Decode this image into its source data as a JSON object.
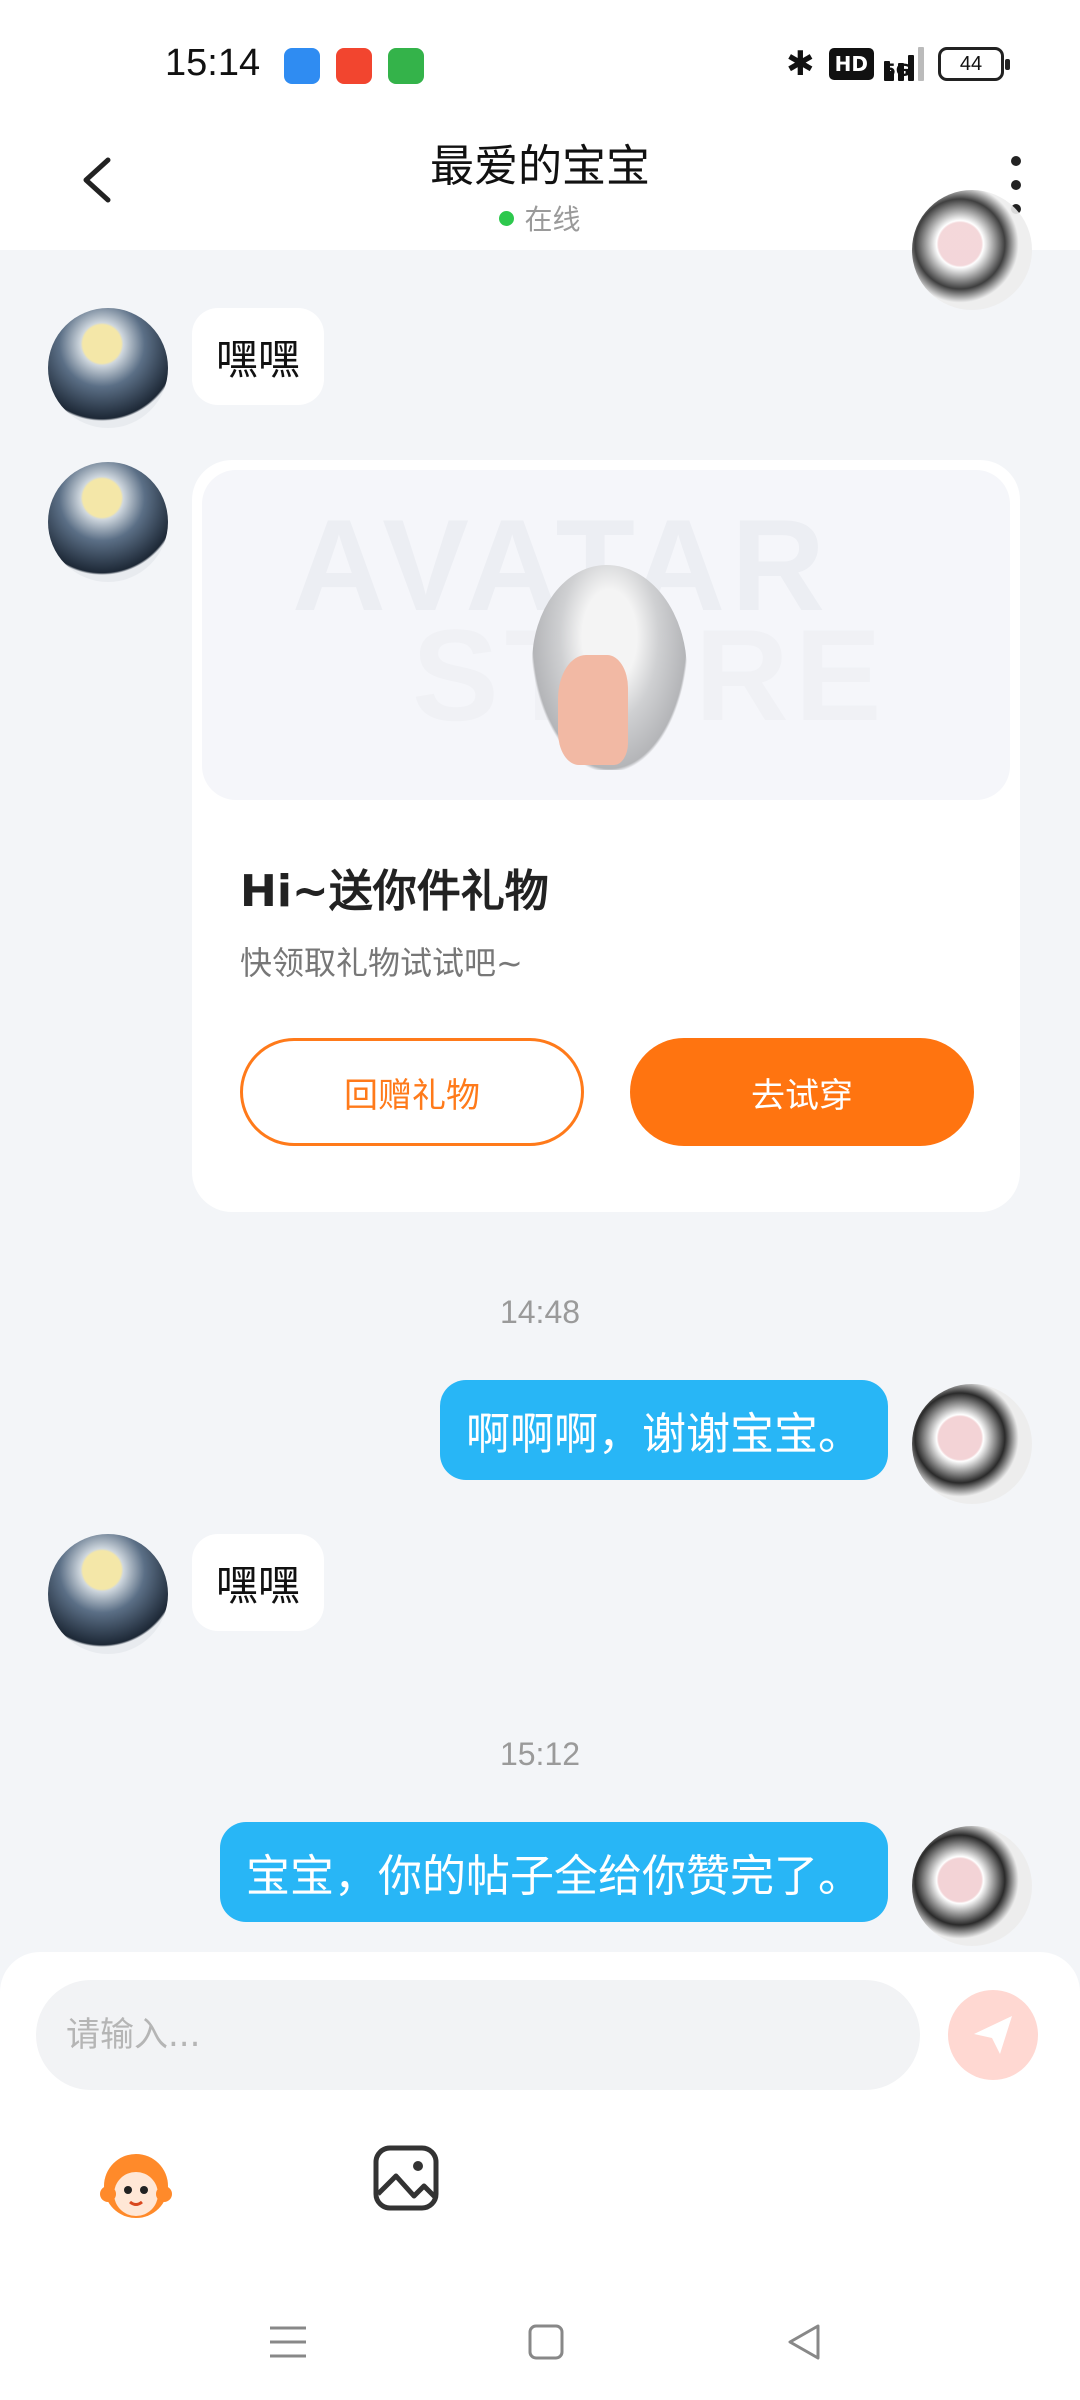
{
  "status_bar": {
    "time": "15:14",
    "battery": "44",
    "network": "5G",
    "hd": "HD",
    "app_icons": [
      "blue-app-icon",
      "video-app-icon",
      "message-app-icon"
    ],
    "app_icon_colors": [
      "#2f8cf2",
      "#f2452f",
      "#34b34a"
    ]
  },
  "header": {
    "title": "最爱的宝宝",
    "status": "在线",
    "status_color": "#2dc84d"
  },
  "messages": [
    {
      "side": "left",
      "text": "嘿嘿"
    },
    {
      "side": "left",
      "type": "gift_card",
      "watermark_line1": "AVATAR",
      "watermark_line2": "STORE",
      "title": "Hi~送你件礼物",
      "subtitle": "快领取礼物试试吧~",
      "secondary_button": "回赠礼物",
      "primary_button": "去试穿"
    },
    {
      "type": "timestamp",
      "text": "14:48"
    },
    {
      "side": "right",
      "text": "啊啊啊，谢谢宝宝。"
    },
    {
      "side": "left",
      "text": "嘿嘿"
    },
    {
      "type": "timestamp",
      "text": "15:12"
    },
    {
      "side": "right",
      "text": "宝宝，你的帖子全给你赞完了。"
    }
  ],
  "input": {
    "placeholder": "请输入..."
  },
  "colors": {
    "accent": "#ff7410",
    "right_bubble": "#28b6f6",
    "background": "#f3f5f8"
  }
}
